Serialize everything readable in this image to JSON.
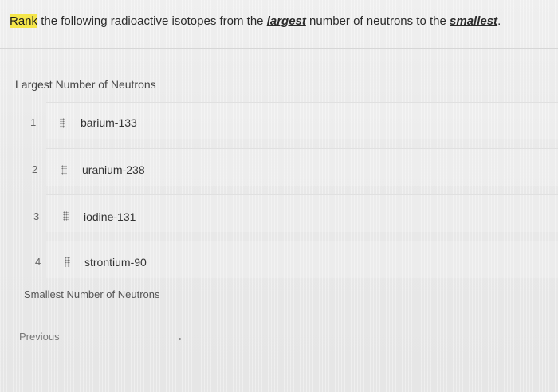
{
  "question": {
    "part1": "Rank",
    "part2": " the following radioactive isotopes from the ",
    "part3": "largest",
    "part4": " number of neutrons to the ",
    "part5": "smallest",
    "part6": "."
  },
  "top_label": "Largest Number of Neutrons",
  "bottom_label": "Smallest Number of Neutrons",
  "items": [
    {
      "rank": "1",
      "label": "barium-133"
    },
    {
      "rank": "2",
      "label": "uranium-238"
    },
    {
      "rank": "3",
      "label": "iodine-131"
    },
    {
      "rank": "4",
      "label": "strontium-90"
    }
  ],
  "previous_label": "Previous",
  "icons": {
    "drag": "drag-handle-icon"
  }
}
